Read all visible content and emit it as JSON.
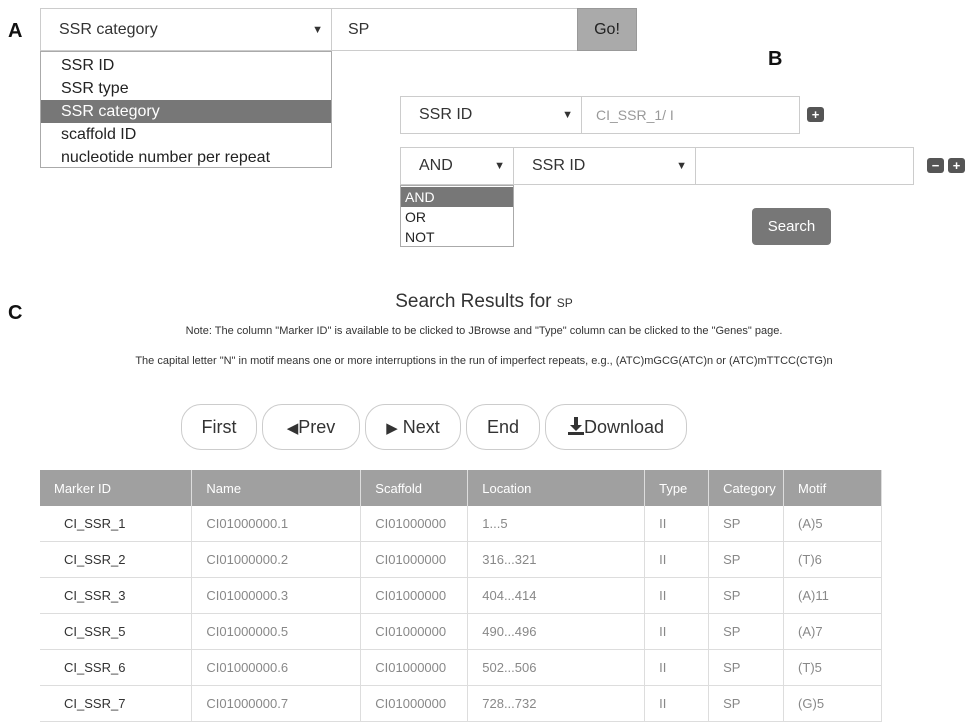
{
  "labels": {
    "a": "A",
    "b": "B",
    "c": "C"
  },
  "panel_a": {
    "select_value": "SSR category",
    "input_value": "SP",
    "go_label": "Go!",
    "options": [
      "SSR ID",
      "SSR type",
      "SSR category",
      "scaffold ID",
      "nucleotide number per repeat"
    ],
    "selected_option": "SSR category"
  },
  "panel_b": {
    "row1_field": "SSR ID",
    "row1_input": "CI_SSR_1/ I",
    "logic_value": "AND",
    "row2_field": "SSR ID",
    "row2_input": "",
    "logic_options": [
      "AND",
      "OR",
      "NOT"
    ],
    "search_label": "Search",
    "plus_glyph": "+",
    "minus_glyph": "−"
  },
  "results": {
    "title": "Search Results for ",
    "query": "SP",
    "note1": "Note: The column \"Marker ID\" is available to be clicked to JBrowse and \"Type\" column can be clicked to the \"Genes\" page.",
    "note2": "The capital letter \"N\" in motif means one or more interruptions in the run of imperfect repeats, e.g., (ATC)mGCG(ATC)n or (ATC)mTTCC(CTG)n",
    "pager": {
      "first": "First",
      "prev": "Prev",
      "next": "Next",
      "end": "End",
      "download": "Download"
    },
    "columns": [
      "Marker ID",
      "Name",
      "Scaffold",
      "Location",
      "Type",
      "Category",
      "Motif"
    ],
    "rows": [
      [
        "CI_SSR_1",
        "CI01000000.1",
        "CI01000000",
        "1...5",
        "II",
        "SP",
        "(A)5"
      ],
      [
        "CI_SSR_2",
        "CI01000000.2",
        "CI01000000",
        "316...321",
        "II",
        "SP",
        "(T)6"
      ],
      [
        "CI_SSR_3",
        "CI01000000.3",
        "CI01000000",
        "404...414",
        "II",
        "SP",
        "(A)11"
      ],
      [
        "CI_SSR_5",
        "CI01000000.5",
        "CI01000000",
        "490...496",
        "II",
        "SP",
        "(A)7"
      ],
      [
        "CI_SSR_6",
        "CI01000000.6",
        "CI01000000",
        "502...506",
        "II",
        "SP",
        "(T)5"
      ],
      [
        "CI_SSR_7",
        "CI01000000.7",
        "CI01000000",
        "728...732",
        "II",
        "SP",
        "(G)5"
      ]
    ]
  }
}
